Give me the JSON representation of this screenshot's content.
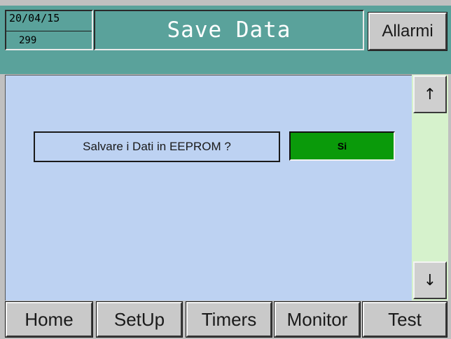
{
  "header": {
    "date": "20/04/15",
    "counter": "299",
    "title": "Save Data",
    "alarm_label": "Allarmi"
  },
  "dialog": {
    "question": "Salvare i Dati in EEPROM ?",
    "yes_label": "Si"
  },
  "scroll": {
    "up_icon": "↑",
    "down_icon": "↓"
  },
  "tabs": [
    {
      "label": "Home"
    },
    {
      "label": "SetUp"
    },
    {
      "label": "Timers"
    },
    {
      "label": "Monitor"
    },
    {
      "label": "Test"
    }
  ],
  "colors": {
    "header_bg": "#5aa29b",
    "panel_bg": "#bdd2f2",
    "scroll_track": "#d6f2cc",
    "yes_button": "#0a9a0a",
    "button_face": "#c9c9c9"
  }
}
